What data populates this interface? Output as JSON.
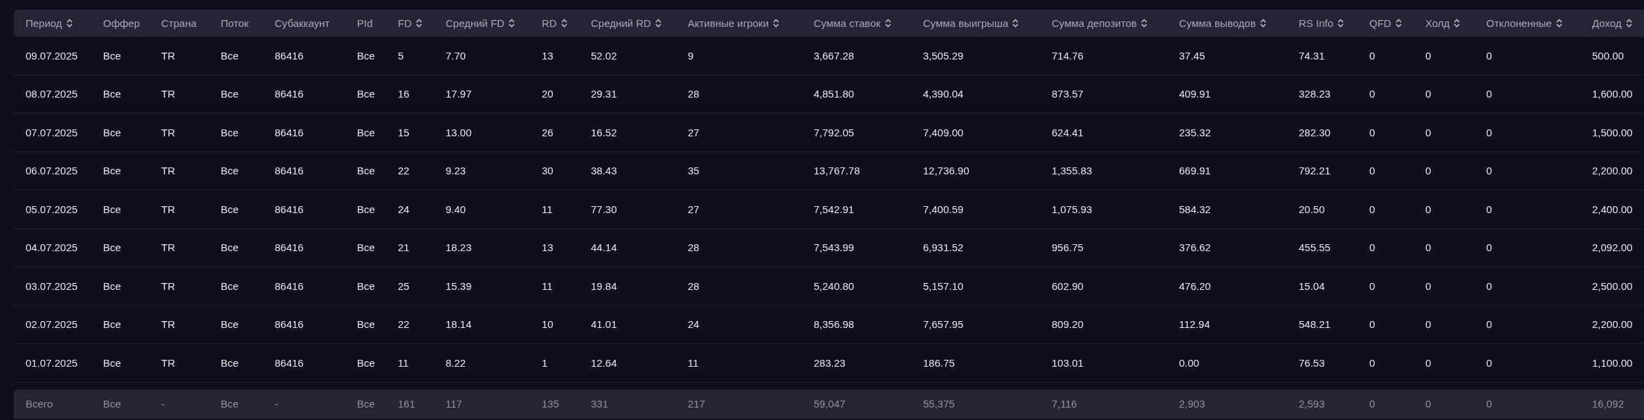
{
  "table": {
    "columns": [
      {
        "label": "Период",
        "sortable": true
      },
      {
        "label": "Оффер",
        "sortable": false
      },
      {
        "label": "Страна",
        "sortable": false
      },
      {
        "label": "Поток",
        "sortable": false
      },
      {
        "label": "Субаккаунт",
        "sortable": false
      },
      {
        "label": "PId",
        "sortable": false
      },
      {
        "label": "FD",
        "sortable": true
      },
      {
        "label": "Средний FD",
        "sortable": true
      },
      {
        "label": "RD",
        "sortable": true
      },
      {
        "label": "Средний RD",
        "sortable": true
      },
      {
        "label": "Активные игроки",
        "sortable": true
      },
      {
        "label": "Сумма ставок",
        "sortable": true
      },
      {
        "label": "Сумма выигрыша",
        "sortable": true
      },
      {
        "label": "Сумма депозитов",
        "sortable": true
      },
      {
        "label": "Сумма выводов",
        "sortable": true
      },
      {
        "label": "RS Info",
        "sortable": true
      },
      {
        "label": "QFD",
        "sortable": true
      },
      {
        "label": "Холд",
        "sortable": true
      },
      {
        "label": "Отклоненные",
        "sortable": true
      },
      {
        "label": "Доход",
        "sortable": true
      }
    ],
    "rows": [
      [
        "09.07.2025",
        "Все",
        "TR",
        "Все",
        "86416",
        "Все",
        "5",
        "7.70",
        "13",
        "52.02",
        "9",
        "3,667.28",
        "3,505.29",
        "714.76",
        "37.45",
        "74.31",
        "0",
        "0",
        "0",
        "500.00"
      ],
      [
        "08.07.2025",
        "Все",
        "TR",
        "Все",
        "86416",
        "Все",
        "16",
        "17.97",
        "20",
        "29.31",
        "28",
        "4,851.80",
        "4,390.04",
        "873.57",
        "409.91",
        "328.23",
        "0",
        "0",
        "0",
        "1,600.00"
      ],
      [
        "07.07.2025",
        "Все",
        "TR",
        "Все",
        "86416",
        "Все",
        "15",
        "13.00",
        "26",
        "16.52",
        "27",
        "7,792.05",
        "7,409.00",
        "624.41",
        "235.32",
        "282.30",
        "0",
        "0",
        "0",
        "1,500.00"
      ],
      [
        "06.07.2025",
        "Все",
        "TR",
        "Все",
        "86416",
        "Все",
        "22",
        "9.23",
        "30",
        "38.43",
        "35",
        "13,767.78",
        "12,736.90",
        "1,355.83",
        "669.91",
        "792.21",
        "0",
        "0",
        "0",
        "2,200.00"
      ],
      [
        "05.07.2025",
        "Все",
        "TR",
        "Все",
        "86416",
        "Все",
        "24",
        "9.40",
        "11",
        "77.30",
        "27",
        "7,542.91",
        "7,400.59",
        "1,075.93",
        "584.32",
        "20.50",
        "0",
        "0",
        "0",
        "2,400.00"
      ],
      [
        "04.07.2025",
        "Все",
        "TR",
        "Все",
        "86416",
        "Все",
        "21",
        "18.23",
        "13",
        "44.14",
        "28",
        "7,543.99",
        "6,931.52",
        "956.75",
        "376.62",
        "455.55",
        "0",
        "0",
        "0",
        "2,092.00"
      ],
      [
        "03.07.2025",
        "Все",
        "TR",
        "Все",
        "86416",
        "Все",
        "25",
        "15.39",
        "11",
        "19.84",
        "28",
        "5,240.80",
        "5,157.10",
        "602.90",
        "476.20",
        "15.04",
        "0",
        "0",
        "0",
        "2,500.00"
      ],
      [
        "02.07.2025",
        "Все",
        "TR",
        "Все",
        "86416",
        "Все",
        "22",
        "18.14",
        "10",
        "41.01",
        "24",
        "8,356.98",
        "7,657.95",
        "809.20",
        "112.94",
        "548.21",
        "0",
        "0",
        "0",
        "2,200.00"
      ],
      [
        "01.07.2025",
        "Все",
        "TR",
        "Все",
        "86416",
        "Все",
        "11",
        "8.22",
        "1",
        "12.64",
        "11",
        "283.23",
        "186.75",
        "103.01",
        "0.00",
        "76.53",
        "0",
        "0",
        "0",
        "1,100.00"
      ]
    ],
    "totals": [
      "Всего",
      "Все",
      "-",
      "Все",
      "-",
      "Все",
      "161",
      "117",
      "135",
      "331",
      "217",
      "59,047",
      "55,375",
      "7,116",
      "2,903",
      "2,593",
      "0",
      "0",
      "0",
      "16,092"
    ]
  }
}
